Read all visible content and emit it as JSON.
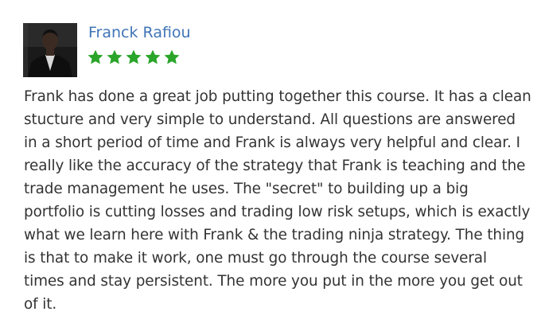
{
  "review": {
    "reviewer_name": "Franck Rafiou",
    "rating": 5,
    "max_rating": 5,
    "star_color": "#2aa52a",
    "name_color": "#3f74b6",
    "text": "Frank has done a great job putting together this course. It has a clean stucture and very simple to understand. All questions are answered in a short period of time and Frank is always very helpful and clear. I really like the accuracy of the strategy that Frank is teaching and the trade management he uses. The \"secret\" to building up a big portfolio is cutting losses and trading low risk setups, which is exactly what we learn here with Frank & the trading ninja strategy. The thing is that to make it work, one must go through the course several times and stay persistent. The more you put in the more you get out of it."
  }
}
